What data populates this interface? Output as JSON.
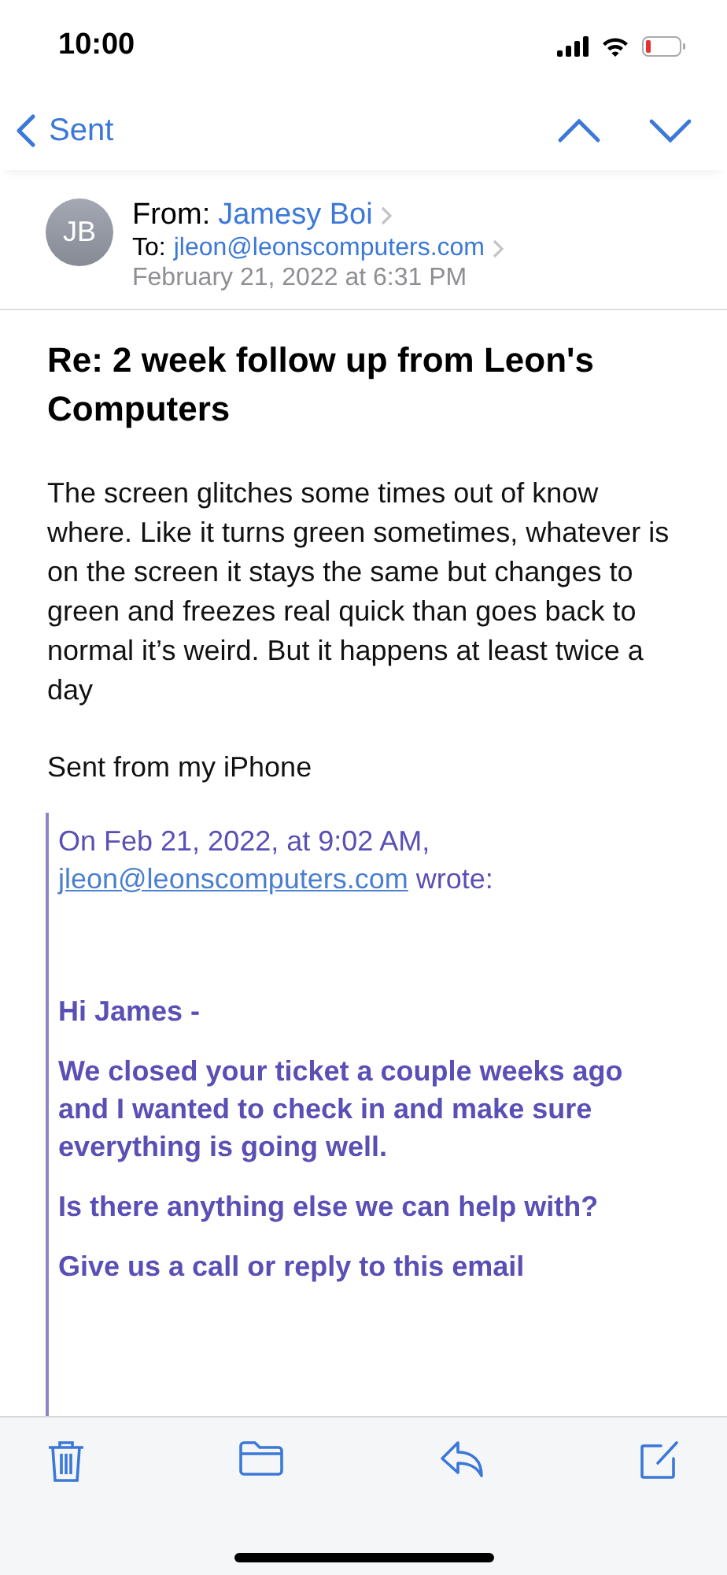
{
  "status_bar": {
    "time": "10:00"
  },
  "nav": {
    "back_label": "Sent"
  },
  "header": {
    "avatar_initials": "JB",
    "from_label": "From:",
    "from_name": "Jamesy Boi",
    "to_label": "To:",
    "to_address": "jleon@leonscomputers.com",
    "date": "February 21, 2022 at 6:31 PM"
  },
  "subject": "Re: 2 week follow up from Leon's Computers",
  "body": [
    "The screen glitches some times out of know where. Like it turns green sometimes, whatever  is on the screen it stays the same but changes to green and freezes real quick than goes back to normal it’s weird. But it happens at least twice a day",
    "Sent from my iPhone"
  ],
  "quote": {
    "intro": "On Feb 21, 2022, at 9:02 AM,",
    "link": "jleon@leonscomputers.com",
    "wrote": "wrote:",
    "paragraphs": [
      "Hi James -",
      "We closed your ticket a couple weeks ago and I wanted to check in and make sure everything is going well.",
      "Is there anything else we can help with?",
      "Give us a call or reply to this email"
    ]
  }
}
